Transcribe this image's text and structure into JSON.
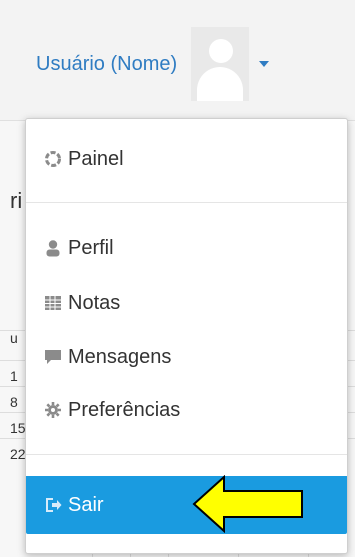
{
  "user_menu": {
    "username": "Usuário (Nome)",
    "items": [
      {
        "label": "Painel",
        "icon": "dashboard-icon"
      },
      {
        "label": "Perfil",
        "icon": "user-icon"
      },
      {
        "label": "Notas",
        "icon": "grades-icon"
      },
      {
        "label": "Mensagens",
        "icon": "message-icon"
      },
      {
        "label": "Preferências",
        "icon": "gear-icon"
      },
      {
        "label": "Sair",
        "icon": "logout-icon"
      }
    ]
  },
  "background": {
    "visible_text": [
      "ri",
      "u",
      "1",
      "8",
      "15",
      "22"
    ]
  },
  "colors": {
    "accent": "#2f7cc2",
    "active_item": "#1a9be0",
    "arrow_fill": "#ffff00",
    "frame_border": "#2f6fc1"
  }
}
